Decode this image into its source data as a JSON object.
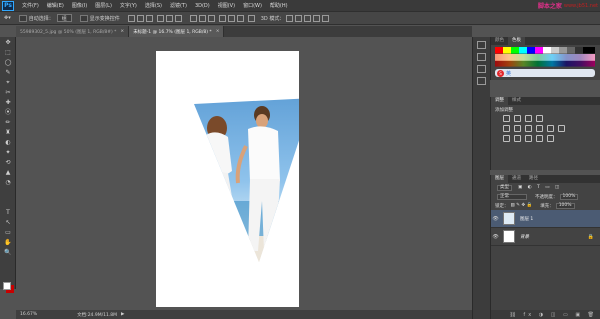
{
  "app": {
    "logo": "Ps"
  },
  "menu": [
    "文件(F)",
    "编辑(E)",
    "图像(I)",
    "图层(L)",
    "文字(Y)",
    "选择(S)",
    "滤镜(T)",
    "3D(D)",
    "视图(V)",
    "窗口(W)",
    "帮助(H)"
  ],
  "watermark": {
    "site_text": "脚本之家",
    "url": "www.jb51.net"
  },
  "options_bar": {
    "auto_select_label": "自动选择：",
    "auto_select_value": "组",
    "show_transform_label": "显示变换控件",
    "mode_3d_label": "3D 模式："
  },
  "tabs": [
    {
      "label": "55989302_5.jpg @ 50% (图层 1, RGB/8#) *",
      "active": false
    },
    {
      "label": "未标题-1 @ 16.7% (图层 1, RGB/8) *",
      "active": true
    }
  ],
  "tools": [
    "✥",
    "⬚",
    "◯",
    "✎",
    "⌖",
    "✂",
    "✚",
    "⦿",
    "✏",
    "♜",
    "◐",
    "✦",
    "⟲",
    "▲",
    "◔",
    "T",
    "↖",
    "▭",
    "✋",
    "🔍"
  ],
  "status": {
    "zoom": "16.67%",
    "doc": "文档:24.9M/11.8M"
  },
  "swatches_panel": {
    "tabs": [
      "颜色",
      "色板"
    ]
  },
  "adjustments_panel": {
    "tabs": [
      "调整",
      "样式"
    ],
    "title": "添加调整"
  },
  "layers_panel": {
    "tabs": [
      "图层",
      "通道",
      "路径"
    ],
    "kind_label": "类型",
    "blend_mode": "正常",
    "opacity_label": "不透明度：",
    "opacity": "100%",
    "lock_label": "锁定：",
    "fill_label": "填充：",
    "fill": "100%",
    "layers": [
      {
        "name": "图层 1",
        "selected": true
      },
      {
        "name": "背景",
        "selected": false
      }
    ]
  },
  "ime": {
    "label": "英"
  }
}
